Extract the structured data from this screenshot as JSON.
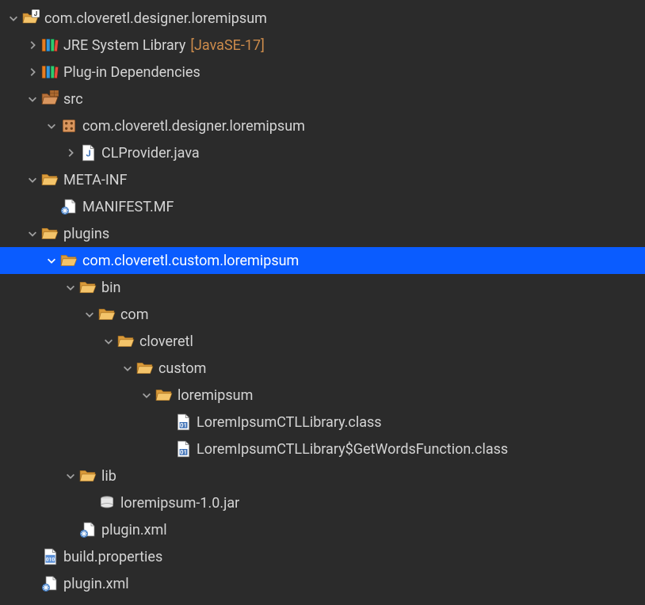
{
  "tree": {
    "project_name": "com.cloveretl.designer.loremipsum",
    "jre_label": "JRE System Library",
    "jre_annot": "[JavaSE-17]",
    "plugin_deps": "Plug-in Dependencies",
    "src": "src",
    "src_pkg": "com.cloveretl.designer.loremipsum",
    "clprovider": "CLProvider.java",
    "metainf": "META-INF",
    "manifest": "MANIFEST.MF",
    "plugins": "plugins",
    "custom_plugin": "com.cloveretl.custom.loremipsum",
    "bin": "bin",
    "com": "com",
    "cloveretl": "cloveretl",
    "custom": "custom",
    "loremipsum": "loremipsum",
    "class1": "LoremIpsumCTLLibrary.class",
    "class2": "LoremIpsumCTLLibrary$GetWordsFunction.class",
    "lib": "lib",
    "jar": "loremipsum-1.0.jar",
    "inner_plugin_xml": "plugin.xml",
    "build_props": "build.properties",
    "root_plugin_xml": "plugin.xml"
  }
}
